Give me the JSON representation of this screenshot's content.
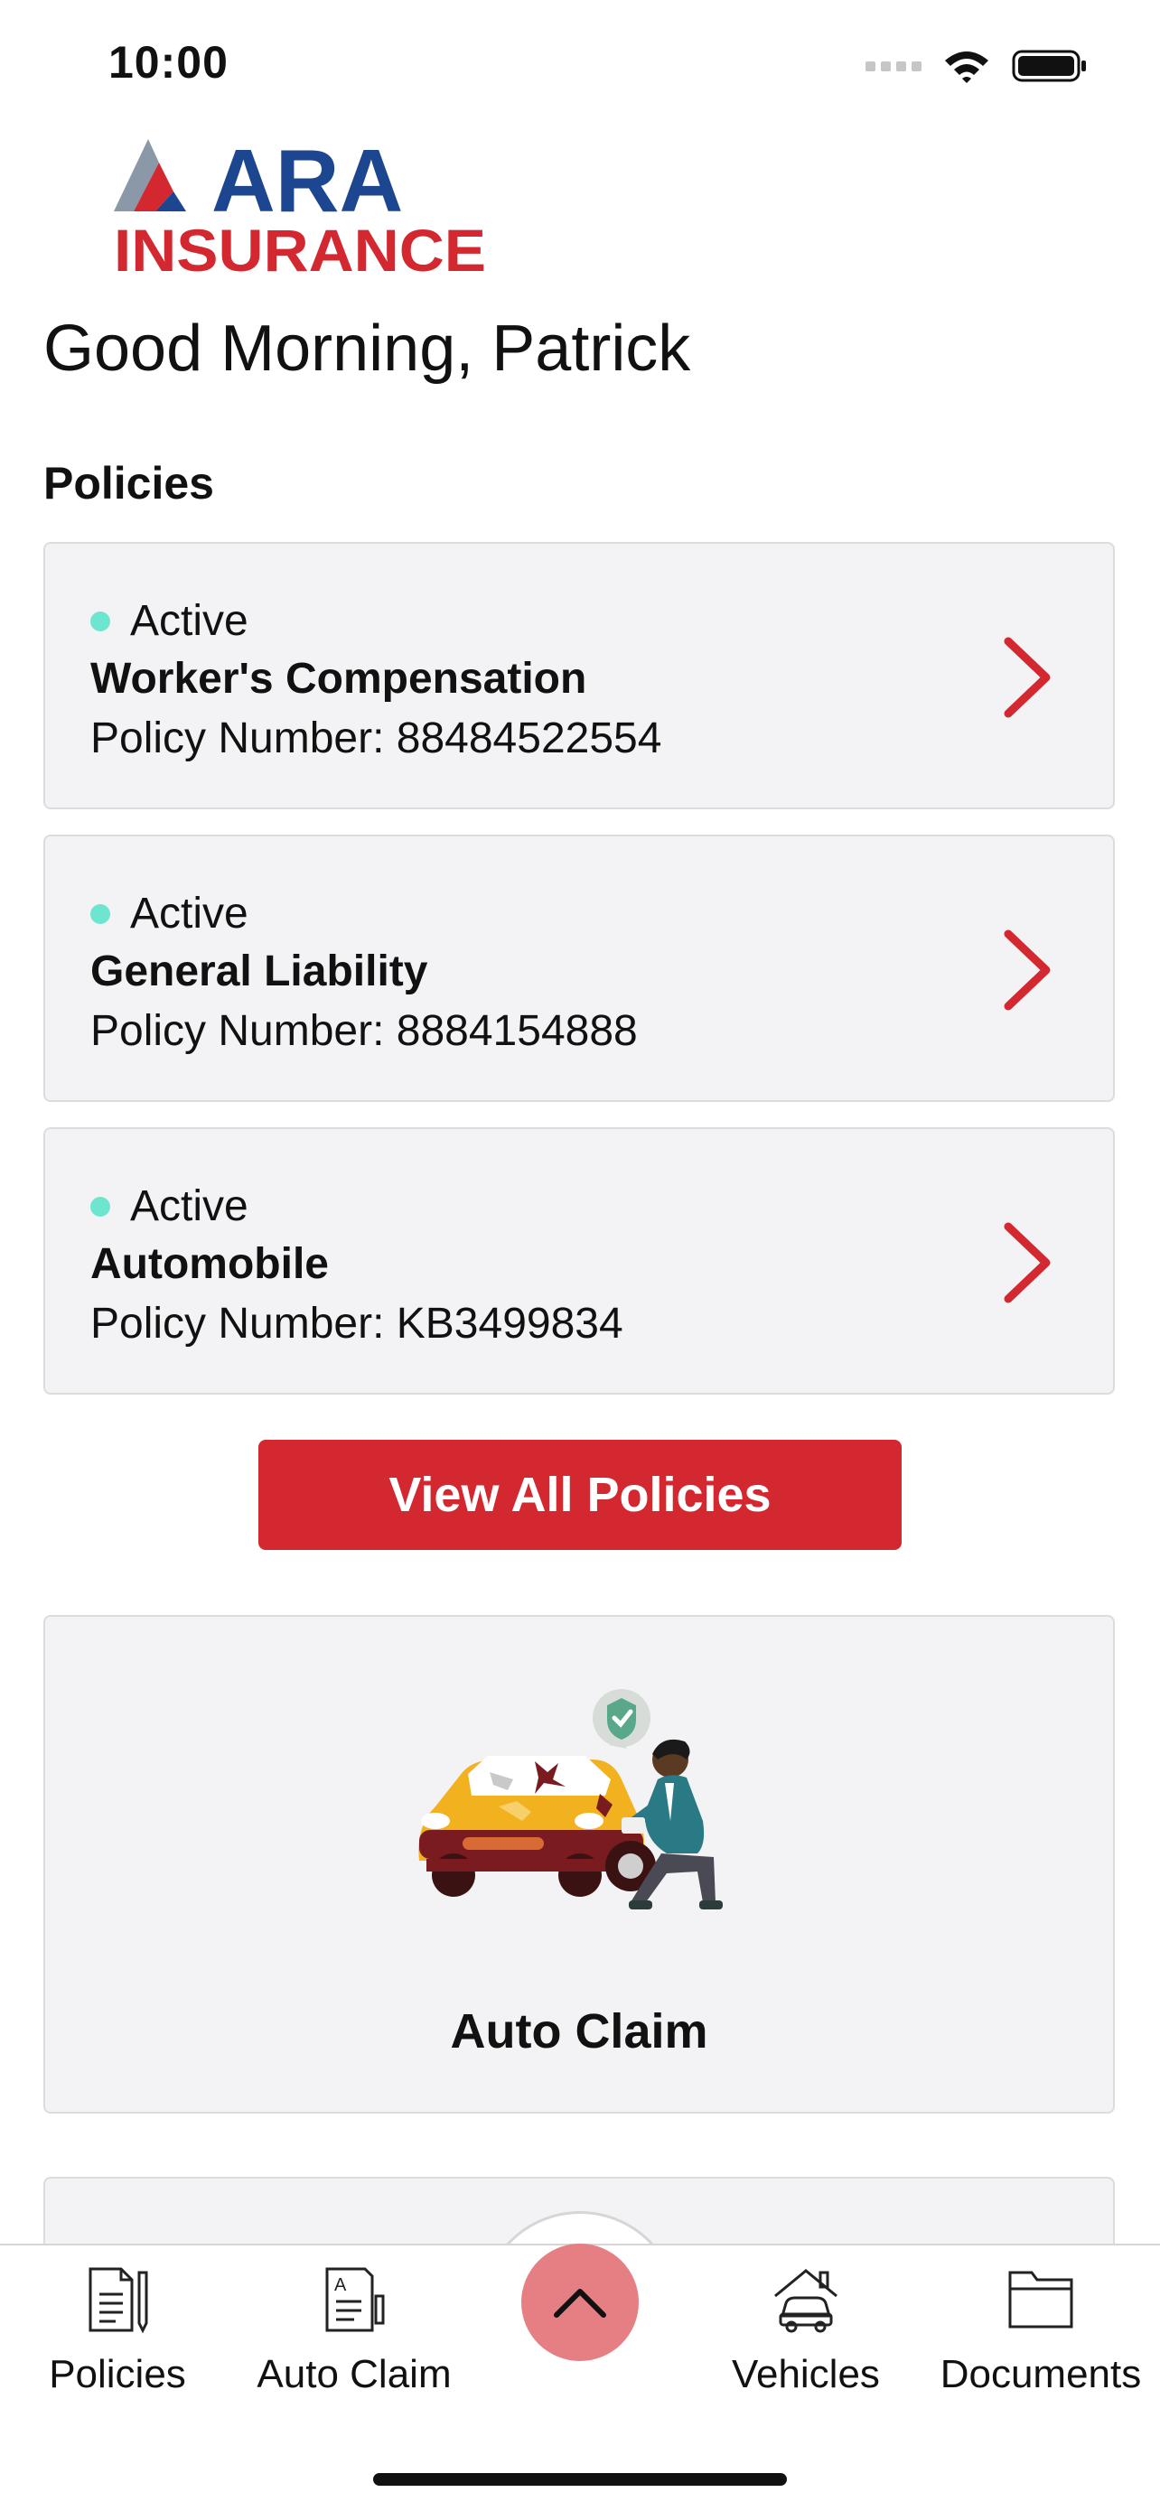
{
  "status_bar": {
    "time": "10:00"
  },
  "brand": {
    "line1": "ARA",
    "line2": "INSURANCE",
    "blue": "#1d4690",
    "red": "#d3282f",
    "grey": "#8a98a8"
  },
  "greeting": "Good Morning, Patrick",
  "policies_section": {
    "title": "Policies"
  },
  "policies": [
    {
      "status": "Active",
      "name": "Worker's Compensation",
      "number": "Policy Number: 88484522554"
    },
    {
      "status": "Active",
      "name": "General Liability",
      "number": "Policy Number: 8884154888"
    },
    {
      "status": "Active",
      "name": "Automobile",
      "number": "Policy Number: KB3499834"
    }
  ],
  "view_all_label": "View All Policies",
  "auto_claim": {
    "title": "Auto Claim"
  },
  "tabs": [
    {
      "label": "Policies",
      "icon": "policies-icon"
    },
    {
      "label": "Auto Claim",
      "icon": "auto-claim-icon"
    },
    {
      "label": "Vehicles",
      "icon": "vehicles-icon"
    },
    {
      "label": "Documents",
      "icon": "documents-icon"
    }
  ],
  "colors": {
    "accent": "#d3282f",
    "status_active": "#6ee6cf",
    "card_bg": "#f3f3f5",
    "fab": "#e57f83"
  }
}
